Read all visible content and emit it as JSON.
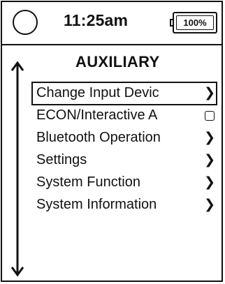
{
  "status_bar": {
    "time": "11:25am",
    "battery_label": "100%"
  },
  "screen": {
    "title": "AUXILIARY"
  },
  "menu": {
    "items": [
      {
        "label": "Change Input Devic",
        "icon": "chevron-right-icon",
        "selected": true
      },
      {
        "label": "ECON/Interactive A",
        "icon": "checkbox-icon",
        "selected": false
      },
      {
        "label": "Bluetooth Operation",
        "icon": "chevron-right-icon",
        "selected": false
      },
      {
        "label": "Settings",
        "icon": "chevron-right-icon",
        "selected": false
      },
      {
        "label": "System Function",
        "icon": "chevron-right-icon",
        "selected": false
      },
      {
        "label": "System Information",
        "icon": "chevron-right-icon",
        "selected": false
      }
    ],
    "chevron_glyph": "❯"
  },
  "colors": {
    "foreground": "#111111",
    "background": "#ffffff"
  }
}
